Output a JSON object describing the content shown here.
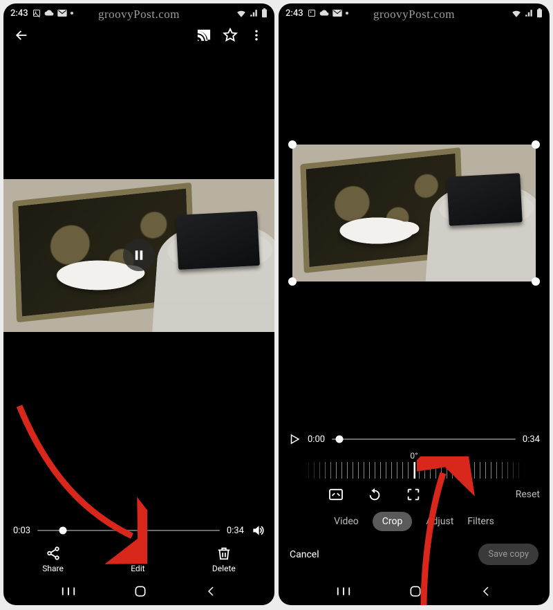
{
  "status": {
    "time": "2:43",
    "watermark": "groovyPost.com"
  },
  "left": {
    "progress": {
      "current": "0:03",
      "total": "0:34",
      "percent": 14
    },
    "actions": {
      "share": "Share",
      "edit": "Edit",
      "delete": "Delete"
    }
  },
  "right": {
    "timeline": {
      "current": "0:00",
      "total": "0:34",
      "percent": 4
    },
    "rotation_label": "0°",
    "reset_label": "Reset",
    "tabs": {
      "video": "Video",
      "crop": "Crop",
      "adjust": "Adjust",
      "filters": "Filters"
    },
    "footer": {
      "cancel": "Cancel",
      "save": "Save copy"
    }
  }
}
